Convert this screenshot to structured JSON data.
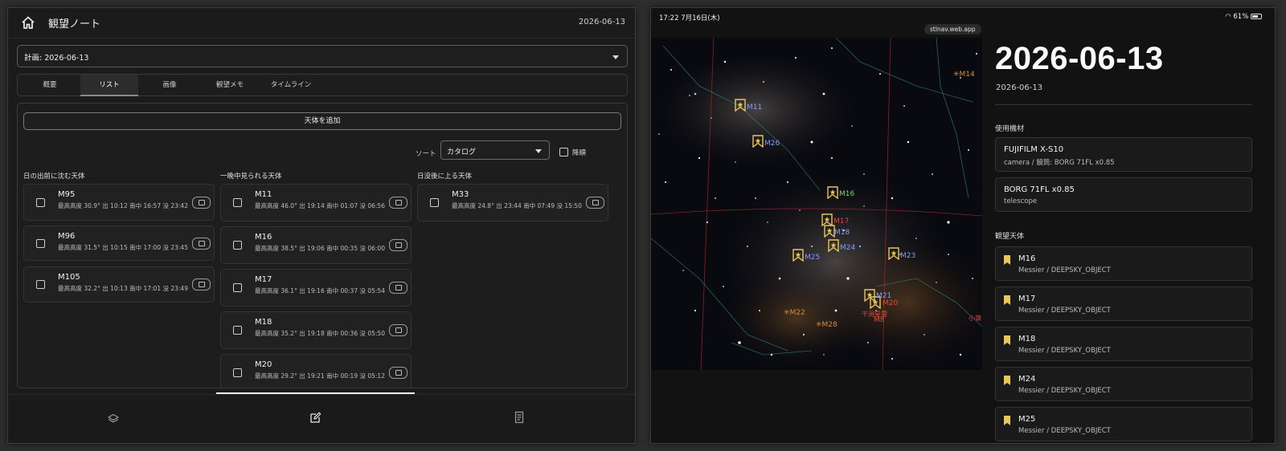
{
  "colors": {
    "accent_yellow": "#e8c65a",
    "label_blue": "#7f9cff",
    "label_red": "#e0483f",
    "label_orange": "#d98a3a",
    "label_green": "#7fd46a"
  },
  "left": {
    "app_title": "観望ノート",
    "top_date": "2026-06-13",
    "plan_select": "計画: 2026-06-13",
    "tabs": [
      "概要",
      "リスト",
      "画像",
      "観望メモ",
      "タイムライン"
    ],
    "active_tab": "リスト",
    "add_button": "天体を追加",
    "sort_label": "ソート",
    "sort_value": "カタログ",
    "desc_label": "降順",
    "columns": [
      {
        "title": "日の出前に沈む天体",
        "items": [
          {
            "name": "M95",
            "detail": "最高高度 30.9° 出 10:12 南中 16:57 没 23:42"
          },
          {
            "name": "M96",
            "detail": "最高高度 31.5° 出 10:15 南中 17:00 没 23:45"
          },
          {
            "name": "M105",
            "detail": "最高高度 32.2° 出 10:13 南中 17:01 没 23:49"
          }
        ]
      },
      {
        "title": "一晩中見られる天体",
        "items": [
          {
            "name": "M11",
            "detail": "最高高度 46.0° 出 19:14 南中 01:07 没 06:56"
          },
          {
            "name": "M16",
            "detail": "最高高度 38.5° 出 19:06 南中 00:35 没 06:00"
          },
          {
            "name": "M17",
            "detail": "最高高度 36.1° 出 19:16 南中 00:37 没 05:54"
          },
          {
            "name": "M18",
            "detail": "最高高度 35.2° 出 19:18 南中 00:36 没 05:50"
          },
          {
            "name": "M20",
            "detail": "最高高度 29.2° 出 19:21 南中 00:19 没 05:12"
          }
        ]
      },
      {
        "title": "日没後に上る天体",
        "items": [
          {
            "name": "M33",
            "detail": "最高高度 24.8° 出 23:44 南中 07:49 没 15:50"
          }
        ]
      }
    ],
    "bottom_nav": [
      "layers-icon",
      "edit-note-icon",
      "document-icon"
    ]
  },
  "right": {
    "status_time": "17:22  7月16日(木)",
    "battery": "61%",
    "url": "stlnav.web.app",
    "big_date": "2026-06-13",
    "sub_date": "2026-06-13",
    "equipment_title": "使用機材",
    "equipment": [
      {
        "name": "FUJIFILM X-S10",
        "sub": "camera / 鏡筒: BORG 71FL x0.85"
      },
      {
        "name": "BORG 71FL x0.85",
        "sub": "telescope"
      }
    ],
    "objects_title": "観望天体",
    "objects": [
      {
        "name": "M16",
        "sub": "Messier / DEEPSKY_OBJECT"
      },
      {
        "name": "M17",
        "sub": "Messier / DEEPSKY_OBJECT"
      },
      {
        "name": "M18",
        "sub": "Messier / DEEPSKY_OBJECT"
      },
      {
        "name": "M24",
        "sub": "Messier / DEEPSKY_OBJECT"
      },
      {
        "name": "M25",
        "sub": "Messier / DEEPSKY_OBJECT"
      }
    ],
    "sky_labels": {
      "m14": "M14",
      "m11": "M11",
      "m26": "M26",
      "m16": "M16",
      "m17": "M17",
      "m18": "M18",
      "m25": "M25",
      "m24": "M24",
      "m23": "M23",
      "m21": "M21",
      "m20": "M20",
      "m22": "M22",
      "m28": "M28",
      "m8": "M8",
      "lagoon": "干潟星雲",
      "small": "小嶺"
    }
  }
}
